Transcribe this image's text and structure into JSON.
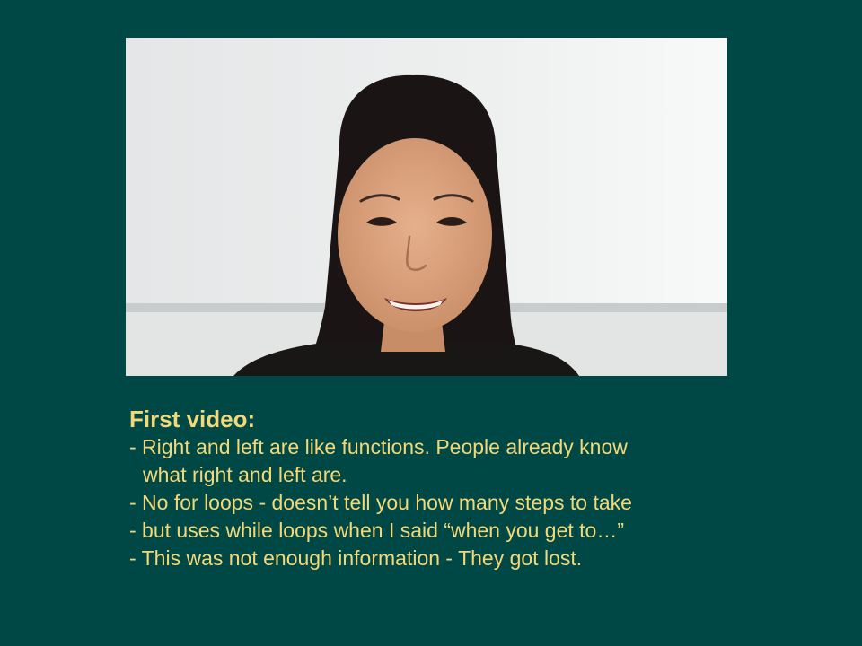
{
  "slide": {
    "background": "#004845",
    "text_color": "#f2d878"
  },
  "video": {
    "description_icon": "speaker-video-person"
  },
  "notes": {
    "title": "First video:",
    "items": [
      {
        "line1": "- Right and left are like functions. People already know",
        "line2": "what right and left are."
      },
      {
        "line1": "- No for loops - doesn’t tell you how many steps to take",
        "line2": ""
      },
      {
        "line1": "- but uses while loops when I said “when you get to…”",
        "line2": ""
      },
      {
        "line1": "- This was not enough information - They got lost.",
        "line2": ""
      }
    ]
  }
}
